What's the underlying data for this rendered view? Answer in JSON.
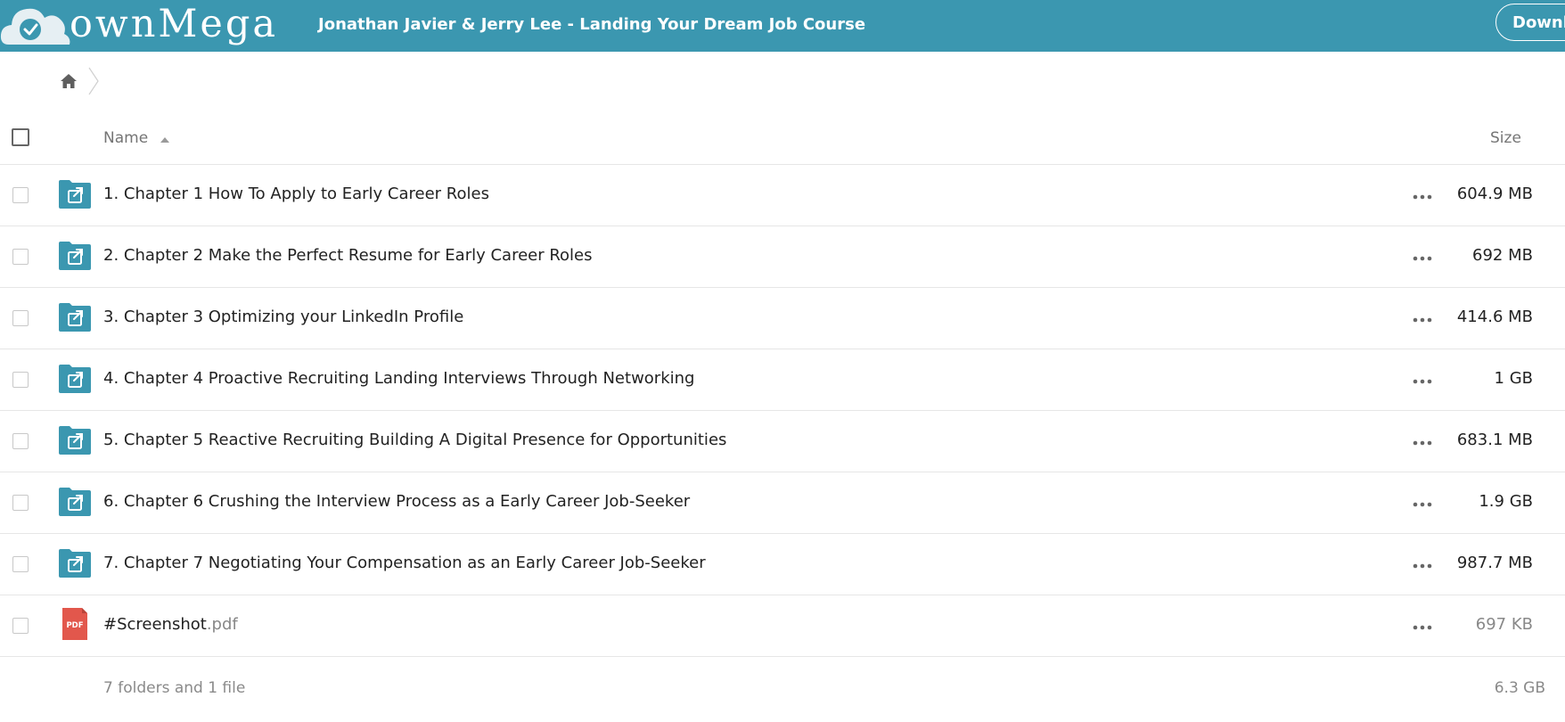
{
  "header": {
    "logo_text": "ownMega",
    "title": "Jonathan Javier & Jerry Lee - Landing Your Dream Job Course",
    "download_label": "Downlo",
    "background_color": "#3b97b0"
  },
  "breadcrumb": {
    "home_icon": "home-icon"
  },
  "table": {
    "columns": {
      "name": "Name",
      "size": "Size"
    },
    "sort": "name-ascending",
    "rows": [
      {
        "type": "folder",
        "icon": "shared-folder-icon",
        "name": "1. Chapter 1 How To Apply to Early Career Roles",
        "size": "604.9 MB"
      },
      {
        "type": "folder",
        "icon": "shared-folder-icon",
        "name": "2. Chapter 2 Make the Perfect Resume for Early Career Roles",
        "size": "692 MB"
      },
      {
        "type": "folder",
        "icon": "shared-folder-icon",
        "name": "3. Chapter 3 Optimizing your LinkedIn Profile",
        "size": "414.6 MB"
      },
      {
        "type": "folder",
        "icon": "shared-folder-icon",
        "name": "4. Chapter 4 Proactive Recruiting Landing Interviews Through Networking",
        "size": "1 GB"
      },
      {
        "type": "folder",
        "icon": "shared-folder-icon",
        "name": "5. Chapter 5 Reactive Recruiting Building A Digital Presence for Opportunities",
        "size": "683.1 MB"
      },
      {
        "type": "folder",
        "icon": "shared-folder-icon",
        "name": "6. Chapter 6 Crushing the Interview Process as a Early Career Job-Seeker",
        "size": "1.9 GB"
      },
      {
        "type": "folder",
        "icon": "shared-folder-icon",
        "name": "7. Chapter 7 Negotiating Your Compensation as an Early Career Job-Seeker",
        "size": "987.7 MB"
      },
      {
        "type": "file",
        "icon": "pdf-icon",
        "icon_label": "PDF",
        "name": "#Screenshot",
        "ext": ".pdf",
        "size": "697 KB"
      }
    ]
  },
  "footer": {
    "summary": "7 folders and 1 file",
    "total": "6.3 GB"
  },
  "colors": {
    "folder": "#3b97b0",
    "pdf": "#e2574c"
  }
}
